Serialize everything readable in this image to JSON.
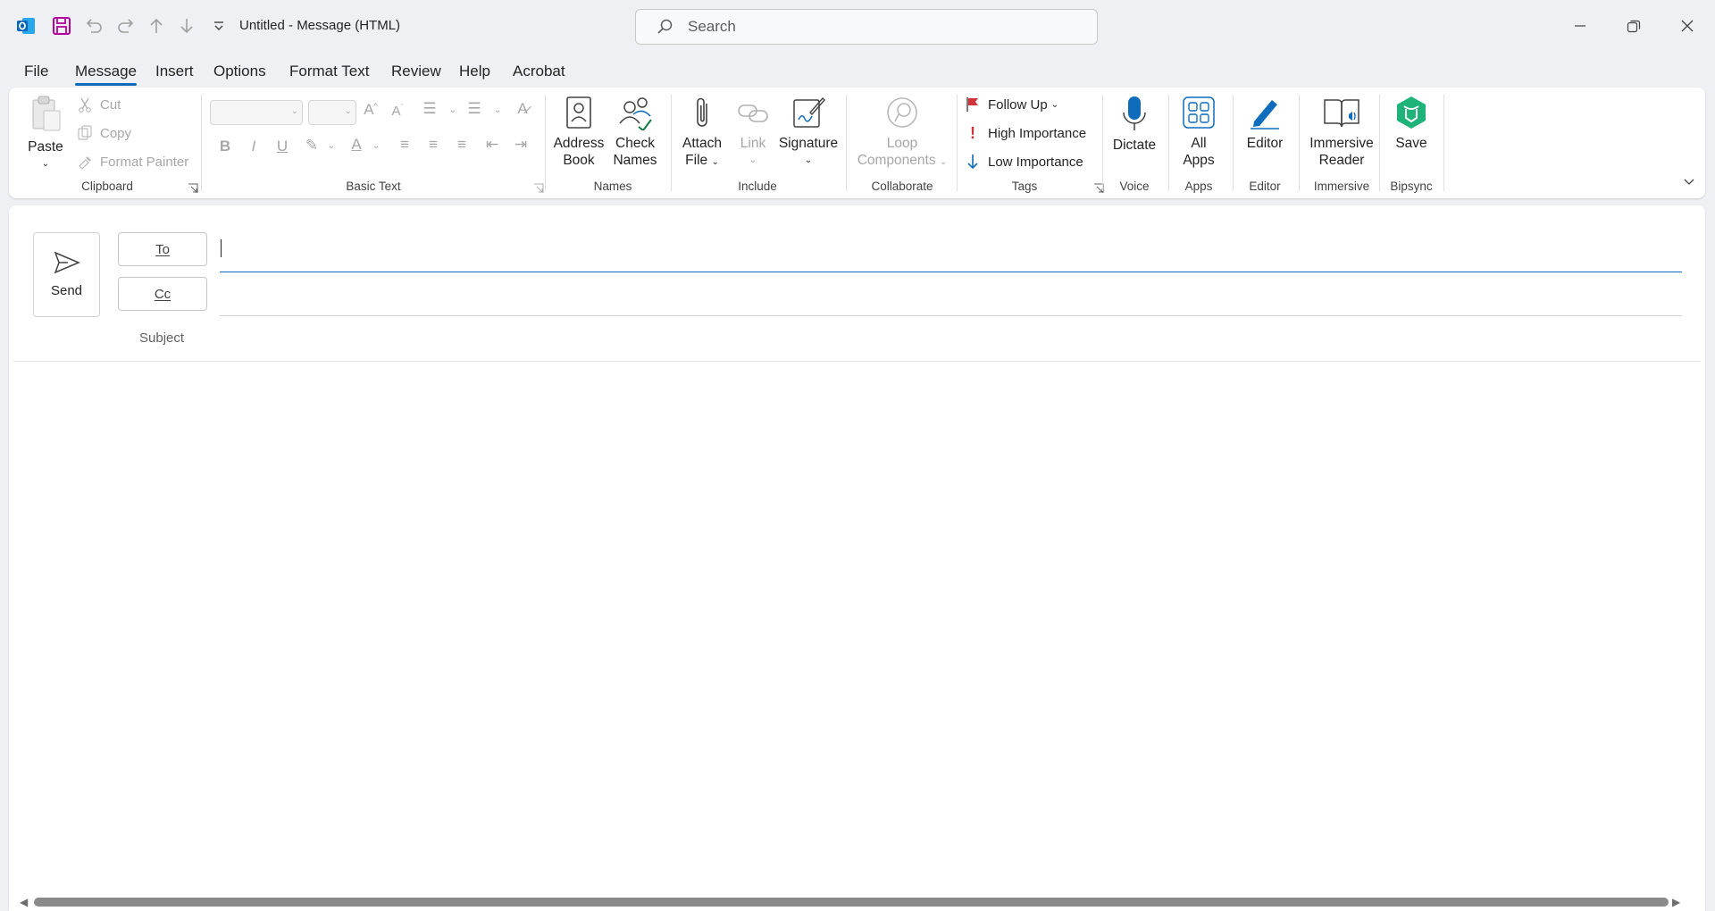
{
  "window": {
    "title": "Untitled  -  Message (HTML)",
    "search_placeholder": "Search"
  },
  "menu": {
    "tabs": [
      "File",
      "Message",
      "Insert",
      "Options",
      "Format Text",
      "Review",
      "Help",
      "Acrobat"
    ],
    "active": "Message"
  },
  "ribbon": {
    "clipboard": {
      "paste": "Paste",
      "cut": "Cut",
      "copy": "Copy",
      "format_painter": "Format Painter",
      "label": "Clipboard"
    },
    "basic_text": {
      "label": "Basic Text"
    },
    "names": {
      "address_book_1": "Address",
      "address_book_2": "Book",
      "check_names_1": "Check",
      "check_names_2": "Names",
      "label": "Names"
    },
    "include": {
      "attach_1": "Attach",
      "attach_2": "File",
      "link": "Link",
      "signature": "Signature",
      "label": "Include"
    },
    "collaborate": {
      "loop_1": "Loop",
      "loop_2": "Components",
      "label": "Collaborate"
    },
    "tags": {
      "follow_up": "Follow Up",
      "high": "High Importance",
      "low": "Low Importance",
      "label": "Tags"
    },
    "voice": {
      "dictate": "Dictate",
      "label": "Voice"
    },
    "apps": {
      "all_1": "All",
      "all_2": "Apps",
      "label": "Apps"
    },
    "editor": {
      "editor": "Editor",
      "label": "Editor"
    },
    "immersive": {
      "reader_1": "Immersive",
      "reader_2": "Reader",
      "label": "Immersive"
    },
    "bipsync": {
      "save": "Save",
      "label": "Bipsync"
    }
  },
  "compose": {
    "send": "Send",
    "to": "To",
    "cc": "Cc",
    "subject": "Subject",
    "to_value": "",
    "cc_value": "",
    "subject_value": ""
  },
  "colors": {
    "accent": "#0f6cbd",
    "outlook_blue": "#0364b8",
    "save_purple": "#b4009e",
    "follow_up_red": "#d13438",
    "bipsync_green": "#1fb37a"
  }
}
